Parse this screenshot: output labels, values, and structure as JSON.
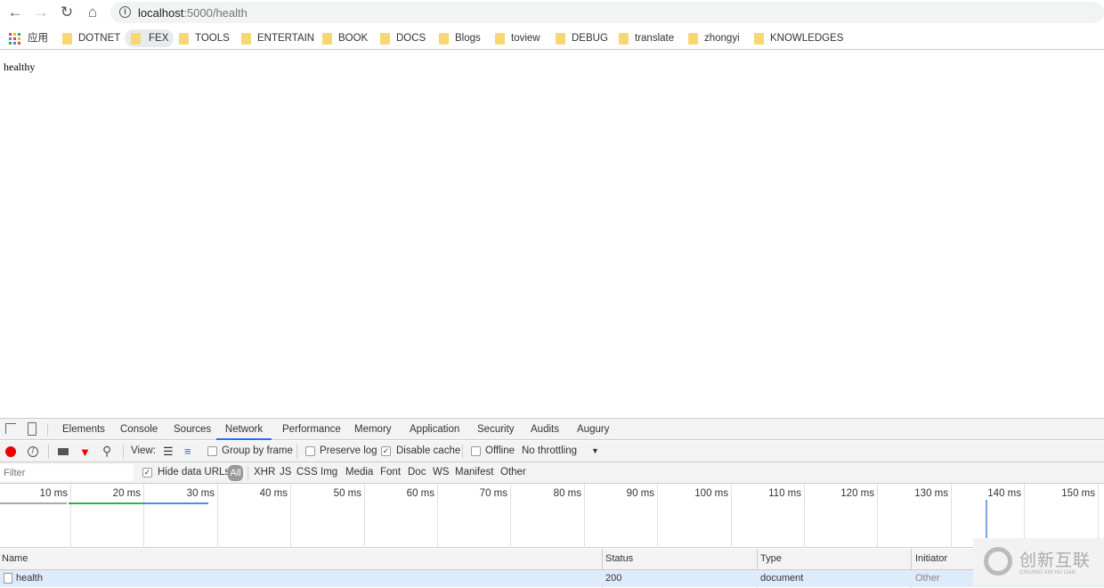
{
  "browser": {
    "url_host": "localhost",
    "url_path": ":5000/health"
  },
  "bookmarks": {
    "apps_label": "应用",
    "items": [
      "DOTNET",
      "FEX",
      "TOOLS",
      "ENTERTAIN",
      "BOOK",
      "DOCS",
      "Blogs",
      "toview",
      "DEBUG",
      "translate",
      "zhongyi",
      "KNOWLEDGES"
    ]
  },
  "page": {
    "body_text": "healthy"
  },
  "devtools": {
    "tabs": [
      "Elements",
      "Console",
      "Sources",
      "Network",
      "Performance",
      "Memory",
      "Application",
      "Security",
      "Audits",
      "Augury"
    ],
    "active_tab": "Network",
    "toolbar": {
      "view_label": "View:",
      "group_by_frame": "Group by frame",
      "preserve_log": "Preserve log",
      "disable_cache": "Disable cache",
      "offline": "Offline",
      "throttling": "No throttling"
    },
    "filter": {
      "placeholder": "Filter",
      "hide_data_urls": "Hide data URLs",
      "types": [
        "All",
        "XHR",
        "JS",
        "CSS",
        "Img",
        "Media",
        "Font",
        "Doc",
        "WS",
        "Manifest",
        "Other"
      ]
    },
    "timeline_ticks": [
      "10 ms",
      "20 ms",
      "30 ms",
      "40 ms",
      "50 ms",
      "60 ms",
      "70 ms",
      "80 ms",
      "90 ms",
      "100 ms",
      "110 ms",
      "120 ms",
      "130 ms",
      "140 ms",
      "150 ms"
    ],
    "columns": [
      "Name",
      "Status",
      "Type",
      "Initiator"
    ],
    "rows": [
      {
        "name": "health",
        "status": "200",
        "type": "document",
        "initiator": "Other"
      }
    ]
  },
  "watermark": {
    "text": "创新互联",
    "subtext": "CHUANG XIN HU LIAN"
  }
}
